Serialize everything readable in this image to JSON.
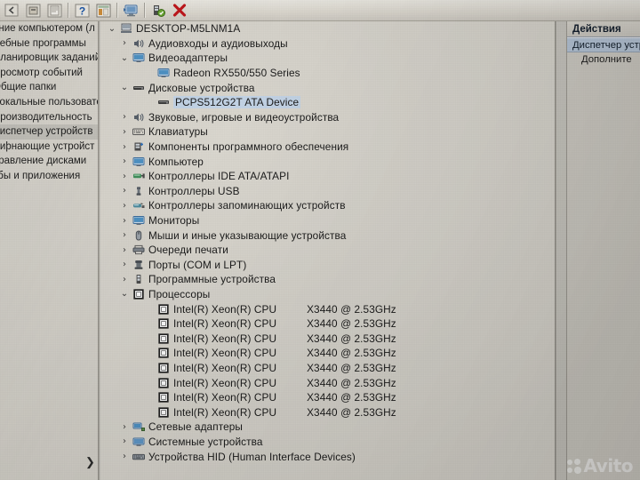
{
  "toolbar": {
    "buttons": [
      {
        "name": "back-button",
        "icon": "back-icon",
        "label": ""
      },
      {
        "name": "properties-button",
        "icon": "properties-icon",
        "label": ""
      },
      {
        "name": "print-button",
        "icon": "print-icon",
        "label": ""
      },
      {
        "name": "help-button",
        "icon": "help-question-icon",
        "label": "?"
      },
      {
        "name": "show-hidden-button",
        "icon": "list-view-icon",
        "label": ""
      },
      {
        "name": "scan-hardware-button",
        "icon": "monitor-scan-icon",
        "label": ""
      },
      {
        "name": "update-driver-button",
        "icon": "green-device-icon",
        "label": ""
      },
      {
        "name": "uninstall-device-button",
        "icon": "red-x-icon",
        "label": "✖"
      }
    ]
  },
  "left_pane": {
    "items": [
      {
        "label": "ение компьютером (л",
        "selected": false
      },
      {
        "label": "жебные программы",
        "selected": false
      },
      {
        "label": "Планировщик заданий",
        "selected": false
      },
      {
        "label": "Просмотр событий",
        "selected": false
      },
      {
        "label": "Общие папки",
        "selected": false
      },
      {
        "label": "Локальные пользовате",
        "selected": false
      },
      {
        "label": "Производительность",
        "selected": false
      },
      {
        "label": "Диспетчер устройств",
        "selected": true
      },
      {
        "label": "миþнающие устройст",
        "selected": false
      },
      {
        "label": "правление дисками",
        "selected": false
      },
      {
        "label": "кбы и приложения",
        "selected": false
      }
    ],
    "expander_glyph": "❯"
  },
  "tree": {
    "root": {
      "label": "DESKTOP-M5LNM1A",
      "icon": "computer-icon",
      "expanded": true
    },
    "nodes": [
      {
        "label": "Аудиовходы и аудиовыходы",
        "icon": "speaker-icon",
        "state": "collapsed",
        "depth": 2
      },
      {
        "label": "Видеоадаптеры",
        "icon": "monitor-blue-icon",
        "state": "expanded",
        "depth": 2
      },
      {
        "label": "Radeon RX550/550 Series",
        "icon": "monitor-blue-icon",
        "state": "leaf",
        "depth": 3
      },
      {
        "label": "Дисковые устройства",
        "icon": "disk-drive-icon",
        "state": "expanded",
        "depth": 2
      },
      {
        "label": "PCPS512G2T ATA Device",
        "icon": "disk-drive-icon",
        "state": "leaf",
        "depth": 3,
        "selected": true
      },
      {
        "label": "Звуковые, игровые и видеоустройства",
        "icon": "speaker-icon",
        "state": "collapsed",
        "depth": 2
      },
      {
        "label": "Клавиатуры",
        "icon": "keyboard-icon",
        "state": "collapsed",
        "depth": 2
      },
      {
        "label": "Компоненты программного обеспечения",
        "icon": "software-component-icon",
        "state": "collapsed",
        "depth": 2
      },
      {
        "label": "Компьютер",
        "icon": "monitor-blue-icon",
        "state": "collapsed",
        "depth": 2
      },
      {
        "label": "Контроллеры IDE ATA/ATAPI",
        "icon": "ide-controller-icon",
        "state": "collapsed",
        "depth": 2
      },
      {
        "label": "Контроллеры USB",
        "icon": "usb-icon",
        "state": "collapsed",
        "depth": 2
      },
      {
        "label": "Контроллеры запоминающих устройств",
        "icon": "storage-controller-icon",
        "state": "collapsed",
        "depth": 2
      },
      {
        "label": "Мониторы",
        "icon": "monitor-blue-icon",
        "state": "collapsed",
        "depth": 2
      },
      {
        "label": "Мыши и иные указывающие устройства",
        "icon": "mouse-icon",
        "state": "collapsed",
        "depth": 2
      },
      {
        "label": "Очереди печати",
        "icon": "printer-icon",
        "state": "collapsed",
        "depth": 2
      },
      {
        "label": "Порты (COM и LPT)",
        "icon": "port-icon",
        "state": "collapsed",
        "depth": 2
      },
      {
        "label": "Программные устройства",
        "icon": "software-device-icon",
        "state": "collapsed",
        "depth": 2
      },
      {
        "label": "Процессоры",
        "icon": "processor-icon",
        "state": "expanded",
        "depth": 2
      }
    ],
    "cpus": [
      {
        "name": "Intel(R) Xeon(R) CPU",
        "model": "X3440  @ 2.53GHz",
        "icon": "processor-icon"
      },
      {
        "name": "Intel(R) Xeon(R) CPU",
        "model": "X3440  @ 2.53GHz",
        "icon": "processor-icon"
      },
      {
        "name": "Intel(R) Xeon(R) CPU",
        "model": "X3440  @ 2.53GHz",
        "icon": "processor-icon"
      },
      {
        "name": "Intel(R) Xeon(R) CPU",
        "model": "X3440  @ 2.53GHz",
        "icon": "processor-icon"
      },
      {
        "name": "Intel(R) Xeon(R) CPU",
        "model": "X3440  @ 2.53GHz",
        "icon": "processor-icon"
      },
      {
        "name": "Intel(R) Xeon(R) CPU",
        "model": "X3440  @ 2.53GHz",
        "icon": "processor-icon"
      },
      {
        "name": "Intel(R) Xeon(R) CPU",
        "model": "X3440  @ 2.53GHz",
        "icon": "processor-icon"
      },
      {
        "name": "Intel(R) Xeon(R) CPU",
        "model": "X3440  @ 2.53GHz",
        "icon": "processor-icon"
      }
    ],
    "tail_nodes": [
      {
        "label": "Сетевые адаптеры",
        "icon": "network-adapter-icon",
        "state": "collapsed",
        "depth": 2
      },
      {
        "label": "Системные устройства",
        "icon": "system-device-icon",
        "state": "collapsed",
        "depth": 2
      },
      {
        "label": "Устройства HID (Human Interface Devices)",
        "icon": "hid-icon",
        "state": "collapsed",
        "depth": 2
      }
    ],
    "glyphs": {
      "expanded": "⌄",
      "collapsed": "›"
    }
  },
  "actions": {
    "header": "Действия",
    "selected_item": "Диспетчер устр",
    "more_item": "Дополните"
  },
  "watermark": {
    "text": "Avito"
  },
  "colors": {
    "selection_blue": "#b7c6d8",
    "tree_selection": "#c3d4e6",
    "window_bg": "#d9d6ce",
    "toolbar_bg": "#ddd9d0",
    "red_x": "#c0161b",
    "help_blue": "#1c56a8",
    "device_green": "#5a8f2b"
  }
}
